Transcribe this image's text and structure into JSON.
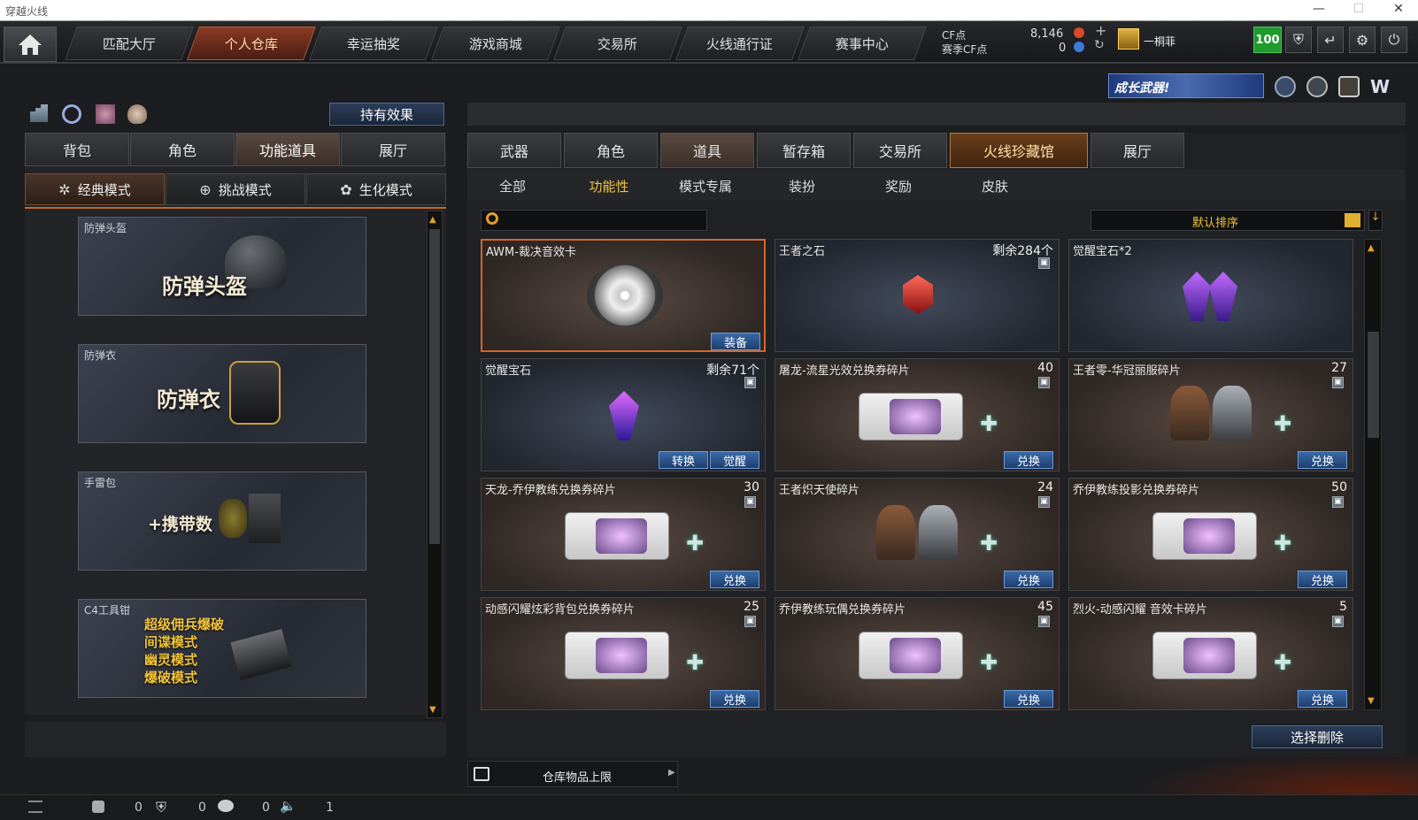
{
  "window": {
    "title": "穿越火线",
    "min": "—",
    "max": "☐",
    "close": "✕"
  },
  "nav": {
    "tabs": [
      "匹配大厅",
      "个人仓库",
      "幸运抽奖",
      "游戏商城",
      "交易所",
      "火线通行证",
      "赛事中心"
    ],
    "active_index": 1
  },
  "currency": {
    "cf_label": "CF点",
    "cf_value": "8,146",
    "season_label": "赛季CF点",
    "season_value": "0",
    "plus": "+",
    "refresh": "↻",
    "player_name": "一桐菲",
    "level_badge": "100"
  },
  "banner": {
    "text": "成长武器!"
  },
  "left": {
    "effects_button": "持有效果",
    "tabs": [
      "背包",
      "角色",
      "功能道具",
      "展厅"
    ],
    "active_tab": 2,
    "modes": [
      "经典模式",
      "挑战模式",
      "生化模式"
    ],
    "active_mode": 0,
    "items": [
      {
        "label": "防弹头盔",
        "big": "防弹头盔"
      },
      {
        "label": "防弹衣",
        "big": "防弹衣"
      },
      {
        "label": "手雷包",
        "big": "+携带数"
      },
      {
        "label": "C4工具钳",
        "lines": [
          "超级佣兵爆破",
          "间谍模式",
          "幽灵模式",
          "爆破模式"
        ]
      }
    ]
  },
  "right": {
    "tabs": [
      "武器",
      "角色",
      "道具",
      "暂存箱",
      "交易所",
      "火线珍藏馆",
      "展厅"
    ],
    "active_tab": 2,
    "special_tab": 5,
    "subtabs": [
      "全部",
      "功能性",
      "模式专属",
      "装扮",
      "奖励",
      "皮肤"
    ],
    "active_subtab": 1,
    "search_placeholder": "",
    "sort_label": "默认排序",
    "items": [
      {
        "name": "AWM-裁决音效卡",
        "qty": "",
        "btns": [
          "装备"
        ],
        "kind": "disc",
        "sel": true,
        "blue": false
      },
      {
        "name": "王者之石",
        "qty": "剩余284个",
        "btns": [],
        "kind": "redgem",
        "blue": true
      },
      {
        "name": "觉醒宝石*2",
        "qty": "",
        "btns": [],
        "kind": "gems2",
        "blue": true
      },
      {
        "name": "觉醒宝石",
        "qty": "剩余71个",
        "btns": [
          "转换",
          "觉醒"
        ],
        "kind": "gem",
        "blue": true
      },
      {
        "name": "屠龙-流星光效兑换券碎片",
        "qty": "40",
        "btns": [
          "兑换"
        ],
        "kind": "ticket"
      },
      {
        "name": "王者零-华冠丽服碎片",
        "qty": "27",
        "btns": [
          "兑换"
        ],
        "kind": "chars"
      },
      {
        "name": "天龙-乔伊教练兑换券碎片",
        "qty": "30",
        "btns": [
          "兑换"
        ],
        "kind": "ticket"
      },
      {
        "name": "王者炽天使碎片",
        "qty": "24",
        "btns": [
          "兑换"
        ],
        "kind": "chars"
      },
      {
        "name": "乔伊教练投影兑换券碎片",
        "qty": "50",
        "btns": [
          "兑换"
        ],
        "kind": "ticket"
      },
      {
        "name": "动感闪耀炫彩背包兑换券碎片",
        "qty": "25",
        "btns": [
          "兑换"
        ],
        "kind": "ticket"
      },
      {
        "name": "乔伊教练玩偶兑换券碎片",
        "qty": "45",
        "btns": [
          "兑换"
        ],
        "kind": "ticket"
      },
      {
        "name": "烈火-动感闪耀 音效卡碎片",
        "qty": "5",
        "btns": [
          "兑换"
        ],
        "kind": "ticket"
      }
    ],
    "delete_button": "选择删除",
    "capacity_label": "仓库物品上限"
  },
  "status": {
    "v1": "0",
    "v2": "0",
    "v3": "0",
    "v4": "1"
  },
  "colors": {
    "accent_orange": "#d4652a",
    "gold_text": "#f3c33a",
    "button_blue": "#2a5aa0",
    "level_green": "#1f9a2c"
  }
}
